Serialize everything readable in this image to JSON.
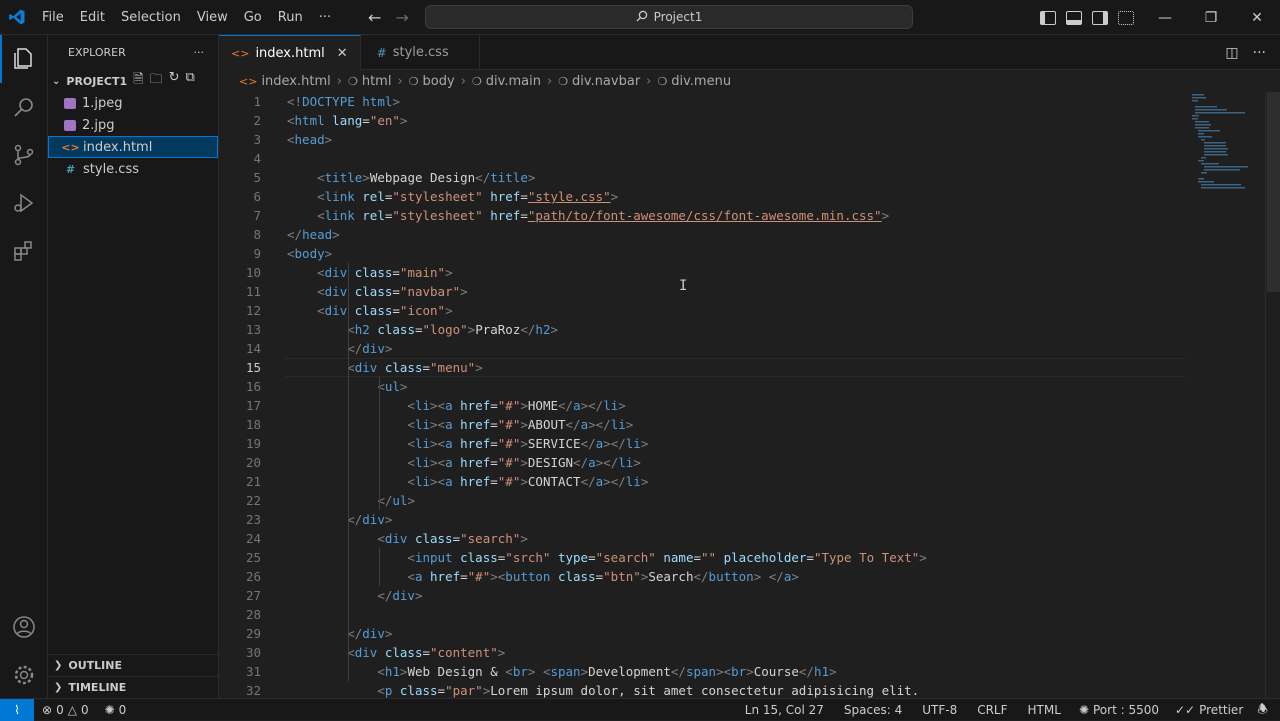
{
  "title_bar": {
    "menu": [
      "File",
      "Edit",
      "Selection",
      "View",
      "Go",
      "Run",
      "···"
    ],
    "command_center": "Project1",
    "window_controls": [
      "minimize",
      "restore",
      "close"
    ]
  },
  "activity_bar": {
    "items": [
      "files-icon",
      "search-icon",
      "source-control-icon",
      "run-debug-icon",
      "extensions-icon"
    ],
    "bottom": [
      "account-icon",
      "settings-gear-icon"
    ]
  },
  "explorer": {
    "header": "EXPLORER",
    "more": "···",
    "project": "PROJECT1",
    "files": [
      {
        "name": "1.jpeg",
        "icon": "image-icon",
        "color": "#a074c4"
      },
      {
        "name": "2.jpg",
        "icon": "image-icon",
        "color": "#a074c4"
      },
      {
        "name": "index.html",
        "icon": "html-icon",
        "color": "#e37933"
      },
      {
        "name": "style.css",
        "icon": "css-icon",
        "color": "#519aba"
      }
    ],
    "sections": [
      "OUTLINE",
      "TIMELINE"
    ]
  },
  "tabs": [
    {
      "label": "index.html",
      "icon": "<>",
      "active": true
    },
    {
      "label": "style.css",
      "icon": "#",
      "active": false
    }
  ],
  "breadcrumb": [
    "index.html",
    "html",
    "body",
    "div.main",
    "div.navbar",
    "div.menu"
  ],
  "editor": {
    "current_line": 15,
    "lines": [
      "<!DOCTYPE html>",
      "<html lang=\"en\">",
      "<head>",
      "",
      "    <title>Webpage Design</title>",
      "    <link rel=\"stylesheet\" href=\"style.css\">",
      "    <link rel=\"stylesheet\" href=\"path/to/font-awesome/css/font-awesome.min.css\">",
      "</head>",
      "<body>",
      "    <div class=\"main\">",
      "    <div class=\"navbar\">",
      "    <div class=\"icon\">",
      "        <h2 class=\"logo\">PraRoz</h2>",
      "        </div>",
      "        <div class=\"menu\">",
      "            <ul>",
      "                <li><a href=\"#\">HOME</a></li>",
      "                <li><a href=\"#\">ABOUT</a></li>",
      "                <li><a href=\"#\">SERVICE</a></li>",
      "                <li><a href=\"#\">DESIGN</a></li>",
      "                <li><a href=\"#\">CONTACT</a></li>",
      "            </ul>",
      "        </div>",
      "            <div class=\"search\">",
      "                <input class=\"srch\" type=\"search\" name=\"\" placeholder=\"Type To Text\">",
      "                <a href=\"#\"><button class=\"btn\">Search</button> </a>",
      "            </div>",
      "",
      "        </div>",
      "        <div class=\"content\">",
      "            <h1>Web Design & <br> <span>Development</span><br>Course</h1>",
      "            <p class=\"par\">Lorem ipsum dolor, sit amet consectetur adipisicing elit."
    ]
  },
  "status_bar": {
    "errors": "0",
    "warnings": "0",
    "ports": "0",
    "position": "Ln 15, Col 27",
    "spaces": "Spaces: 4",
    "encoding": "UTF-8",
    "eol": "CRLF",
    "language": "HTML",
    "port": "Port : 5500",
    "prettier": "Prettier"
  },
  "colors": {
    "accent": "#0078d4",
    "tag": "#569cd6",
    "attr": "#9cdcfe",
    "string": "#ce9178",
    "text": "#d4d4d4",
    "bracket": "#808080"
  }
}
